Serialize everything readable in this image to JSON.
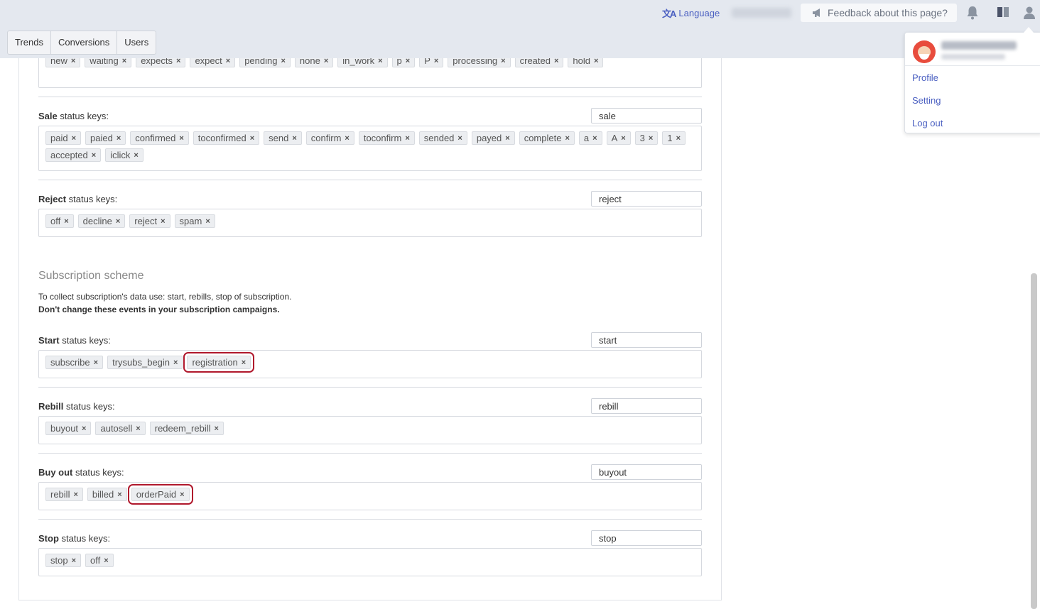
{
  "topbar": {
    "language_label": "Language",
    "language_icon": "translate-icon",
    "feedback_label": "Feedback about this page?",
    "feedback_icon": "megaphone-icon",
    "icons": [
      "bell-icon",
      "book-icon",
      "user-icon"
    ]
  },
  "tabs": [
    {
      "label": "Trends"
    },
    {
      "label": "Conversions"
    },
    {
      "label": "Users"
    }
  ],
  "user_menu": {
    "items": [
      {
        "label": "Profile"
      },
      {
        "label": "Setting"
      },
      {
        "label": "Log out"
      }
    ]
  },
  "pending_row": {
    "tags": [
      "new",
      "waiting",
      "expects",
      "expect",
      "pending",
      "none",
      "in_work",
      "p",
      "P",
      "processing",
      "created",
      "hold"
    ]
  },
  "sale_row": {
    "label_bold": "Sale",
    "label_rest": " status keys:",
    "key_value": "sale",
    "tags": [
      "paid",
      "paied",
      "confirmed",
      "toconfirmed",
      "send",
      "confirm",
      "toconfirm",
      "sended",
      "payed",
      "complete",
      "a",
      "A",
      "3",
      "1",
      "accepted",
      "iclick"
    ]
  },
  "reject_row": {
    "label_bold": "Reject",
    "label_rest": " status keys:",
    "key_value": "reject",
    "tags": [
      "off",
      "decline",
      "reject",
      "spam"
    ]
  },
  "subscription": {
    "title": "Subscription scheme",
    "desc_line1": "To collect subscription's data use: start, rebills, stop of subscription.",
    "desc_line2": "Don't change these events in your subscription campaigns."
  },
  "start_row": {
    "label_bold": "Start",
    "label_rest": " status keys:",
    "key_value": "start",
    "tags": [
      "subscribe",
      "trysubs_begin",
      "registration"
    ],
    "highlighted": "registration"
  },
  "rebill_row": {
    "label_bold": "Rebill",
    "label_rest": " status keys:",
    "key_value": "rebill",
    "tags": [
      "buyout",
      "autosell",
      "redeem_rebill"
    ]
  },
  "buyout_row": {
    "label_bold": "Buy out",
    "label_rest": " status keys:",
    "key_value": "buyout",
    "tags": [
      "rebill",
      "billed",
      "orderPaid"
    ],
    "highlighted": "orderPaid"
  },
  "stop_row": {
    "label_bold": "Stop",
    "label_rest": " status keys:",
    "key_value": "stop",
    "tags": [
      "stop",
      "off"
    ]
  },
  "colors": {
    "accent": "#4a5fc1",
    "highlight": "#b0182c",
    "topbar": "#e4e8ef"
  }
}
